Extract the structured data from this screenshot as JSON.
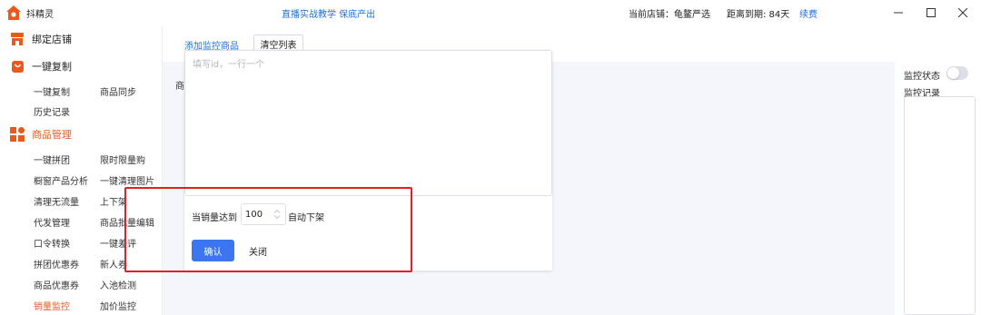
{
  "titlebar": {
    "app_name": "抖精灵",
    "promo": "直播实战教学 保底产出",
    "current_store": "当前店铺：龟鳌严选",
    "expire": "距离到期:  84天",
    "renew": "续费"
  },
  "sidebar": {
    "bind_store": "绑定店铺",
    "one_click_copy": "一键复制",
    "copy_items": [
      "一键复制",
      "商品同步",
      "历史记录"
    ],
    "product_mgmt": "商品管理",
    "mgmt_items": [
      "一键拼团",
      "限时限量购",
      "橱窗产品分析",
      "一键清理图片",
      "清理无流量",
      "上下架",
      "代发管理",
      "商品批量编辑",
      "口令转换",
      "一键差评",
      "拼团优惠券",
      "新人券",
      "商品优惠券",
      "入池检测",
      "销量监控",
      "加价监控"
    ],
    "active_item": "销量监控"
  },
  "main": {
    "tab_add": "添加监控商品",
    "tab_clear": "清空列表",
    "truncated_label": "商",
    "id_placeholder": "填写id，一行一个",
    "threshold_prefix": "当销量达到",
    "threshold_value": "100",
    "threshold_suffix": "自动下架",
    "confirm": "确认",
    "close": "关闭"
  },
  "right": {
    "monitor_status": "监控状态",
    "monitor_log": "监控记录",
    "toggle_on": false
  },
  "colors": {
    "accent_orange": "#e85a1b",
    "link_blue": "#1f6fd6",
    "primary_button": "#3b76f0",
    "highlight_red": "#e51c23"
  }
}
